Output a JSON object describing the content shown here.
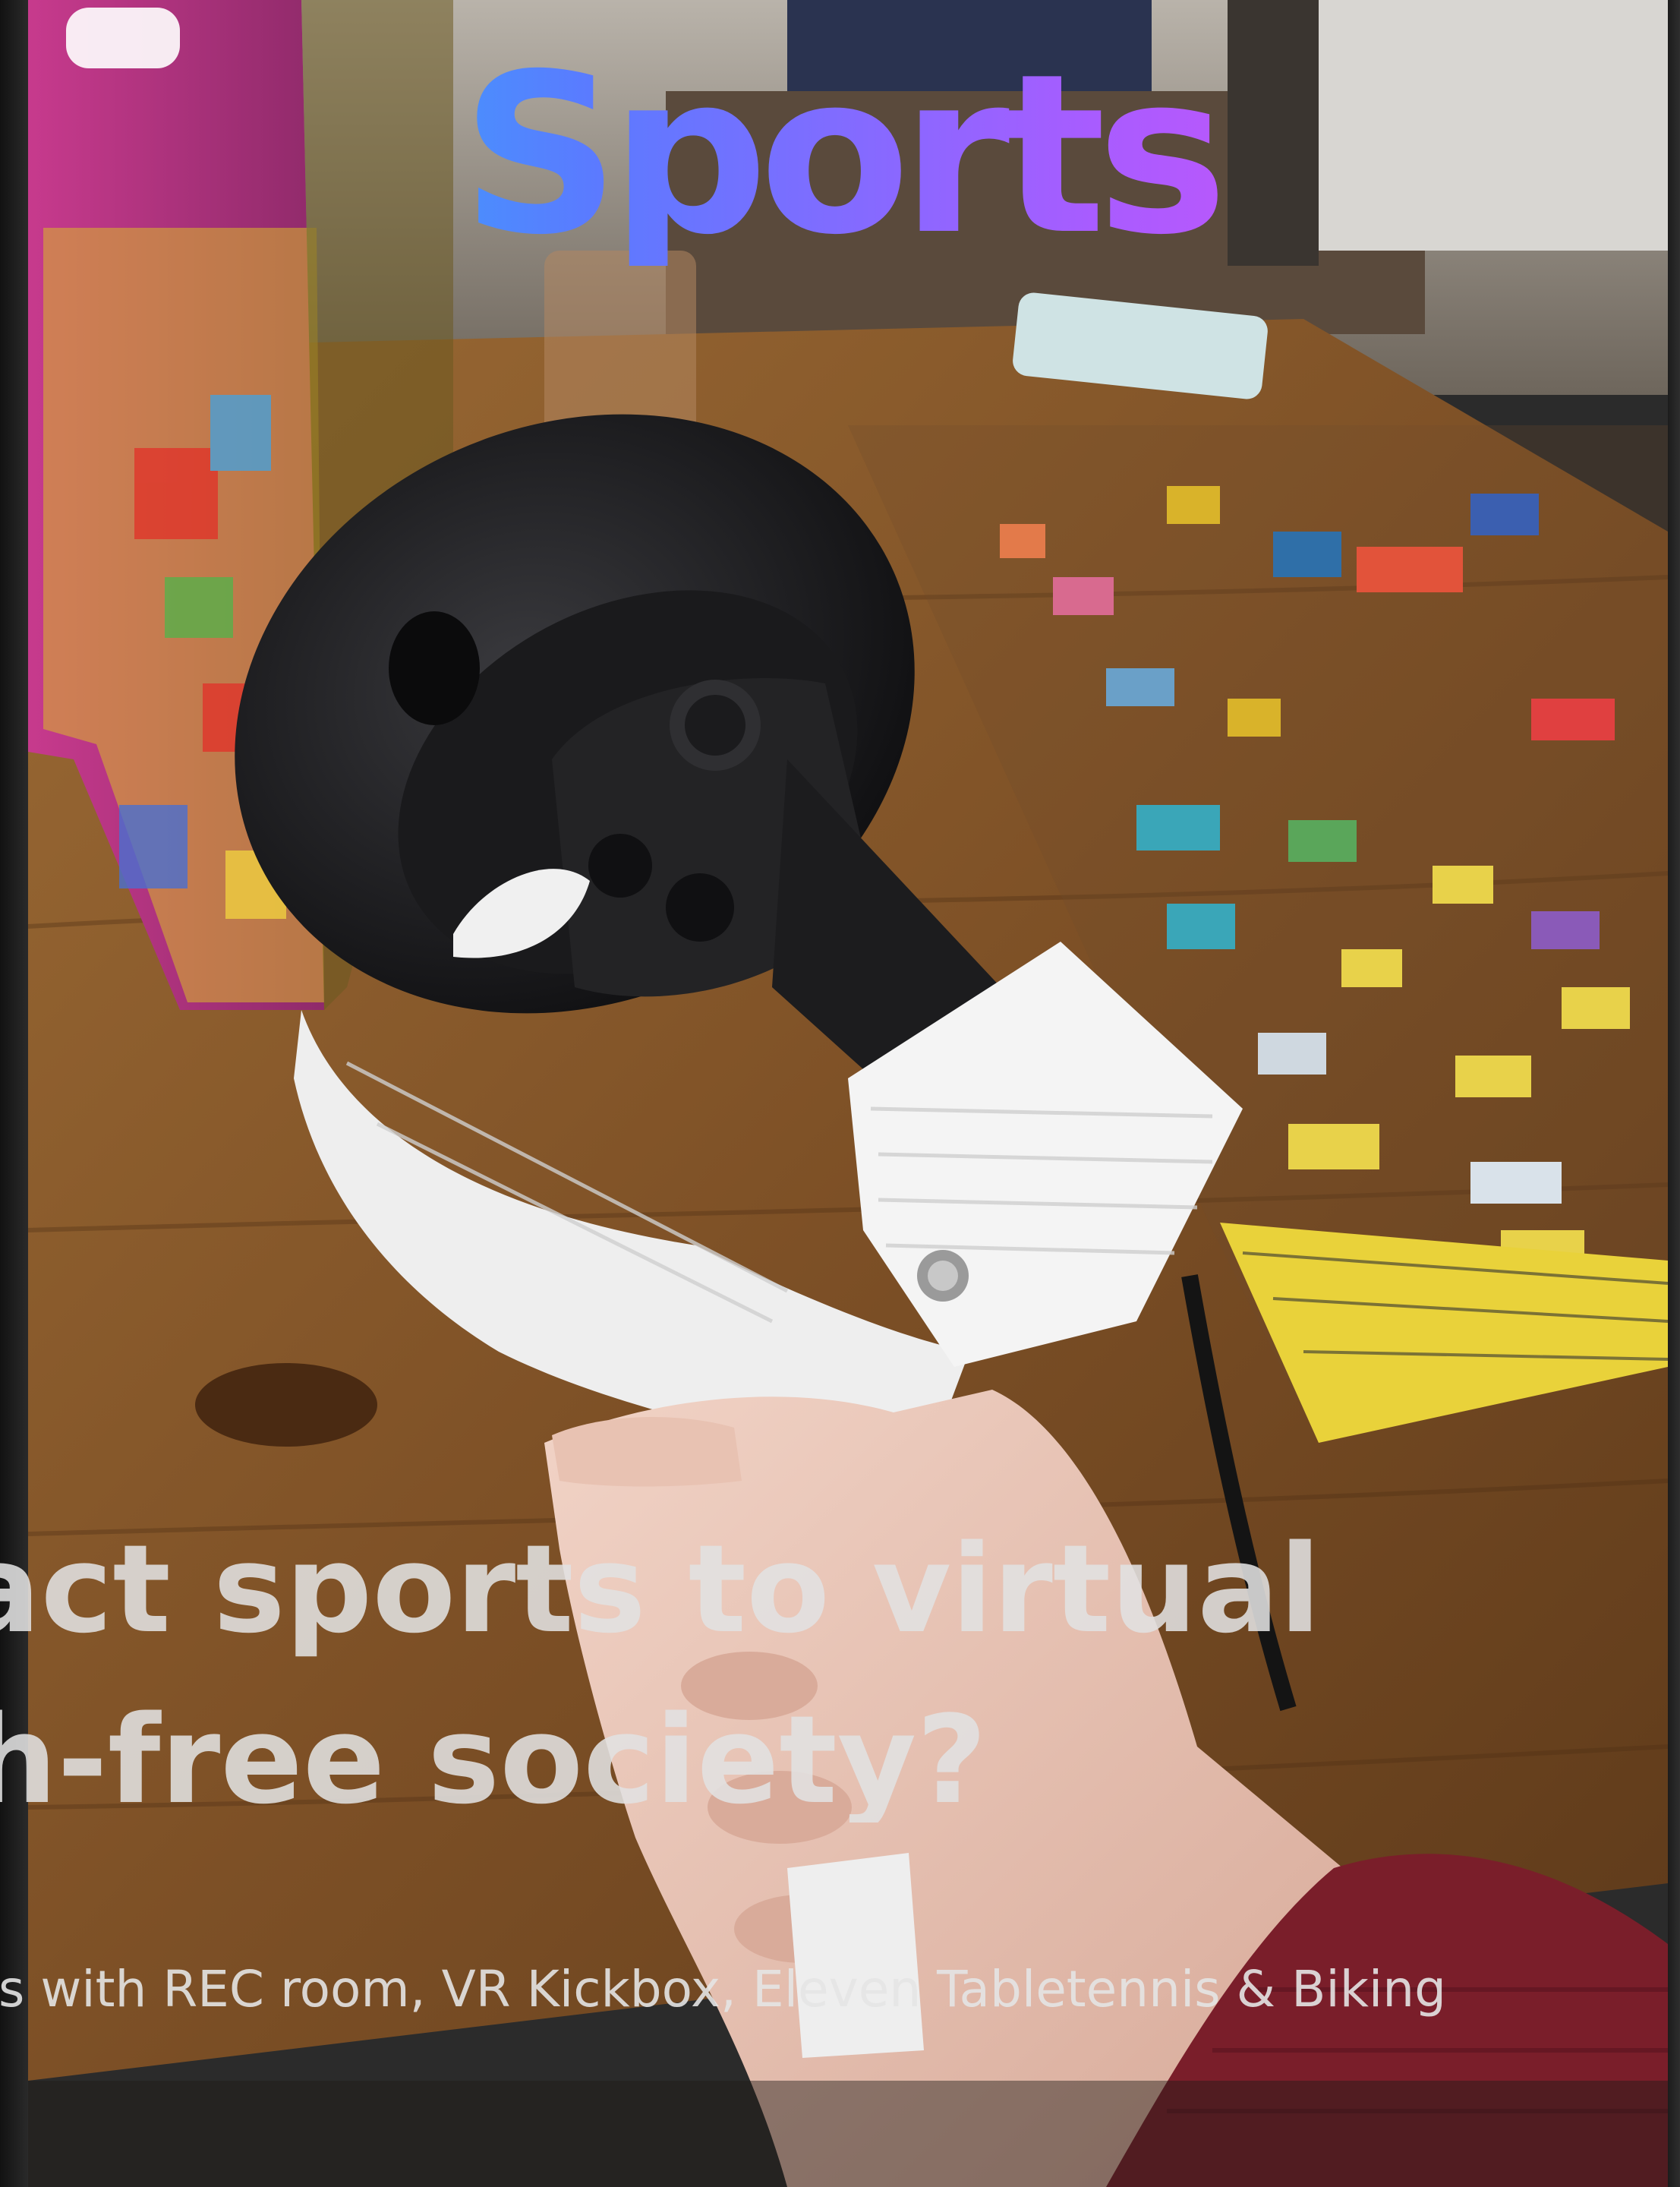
{
  "slide": {
    "title": "Sports",
    "headline_line1": "ntact sports to virtual",
    "headline_line2": "ch-free society?",
    "subtitle": "s with REC room, VR Kickbox, Eleven Tabletennis & Biking"
  },
  "photo": {
    "subject": "vr-controller-with-3d-printed-grip",
    "colors": {
      "table": "#8a5a2c",
      "controller": "#1c1c1e",
      "grip": "#f2f2f2",
      "sleeve": "#7a1e2a",
      "puzzle_box": "#b0307a"
    }
  }
}
